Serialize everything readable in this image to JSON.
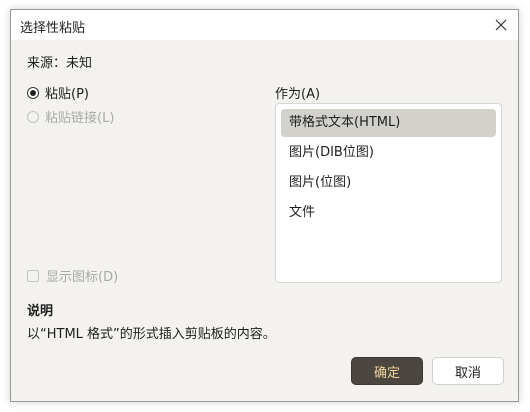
{
  "window": {
    "title": "选择性粘贴"
  },
  "source": {
    "text": "来源：未知"
  },
  "options": {
    "paste_label": "粘贴(P)",
    "paste_link_label": "粘贴链接(L)",
    "show_icon_label": "显示图标(D)"
  },
  "as": {
    "label": "作为(A)",
    "items": [
      {
        "label": "带格式文本(HTML)",
        "selected": true
      },
      {
        "label": "图片(DIB位图)",
        "selected": false
      },
      {
        "label": "图片(位图)",
        "selected": false
      },
      {
        "label": "文件",
        "selected": false
      }
    ]
  },
  "description": {
    "title": "说明",
    "text": "以“HTML 格式”的形式插入剪贴板的内容。"
  },
  "buttons": {
    "ok_label": "确定",
    "cancel_label": "取消"
  },
  "colors": {
    "ok_bg": "#4b4640",
    "ok_text": "#f0d79c",
    "dialog_bg": "#f3f2ee",
    "selected_item_bg": "#d3d1cc"
  }
}
